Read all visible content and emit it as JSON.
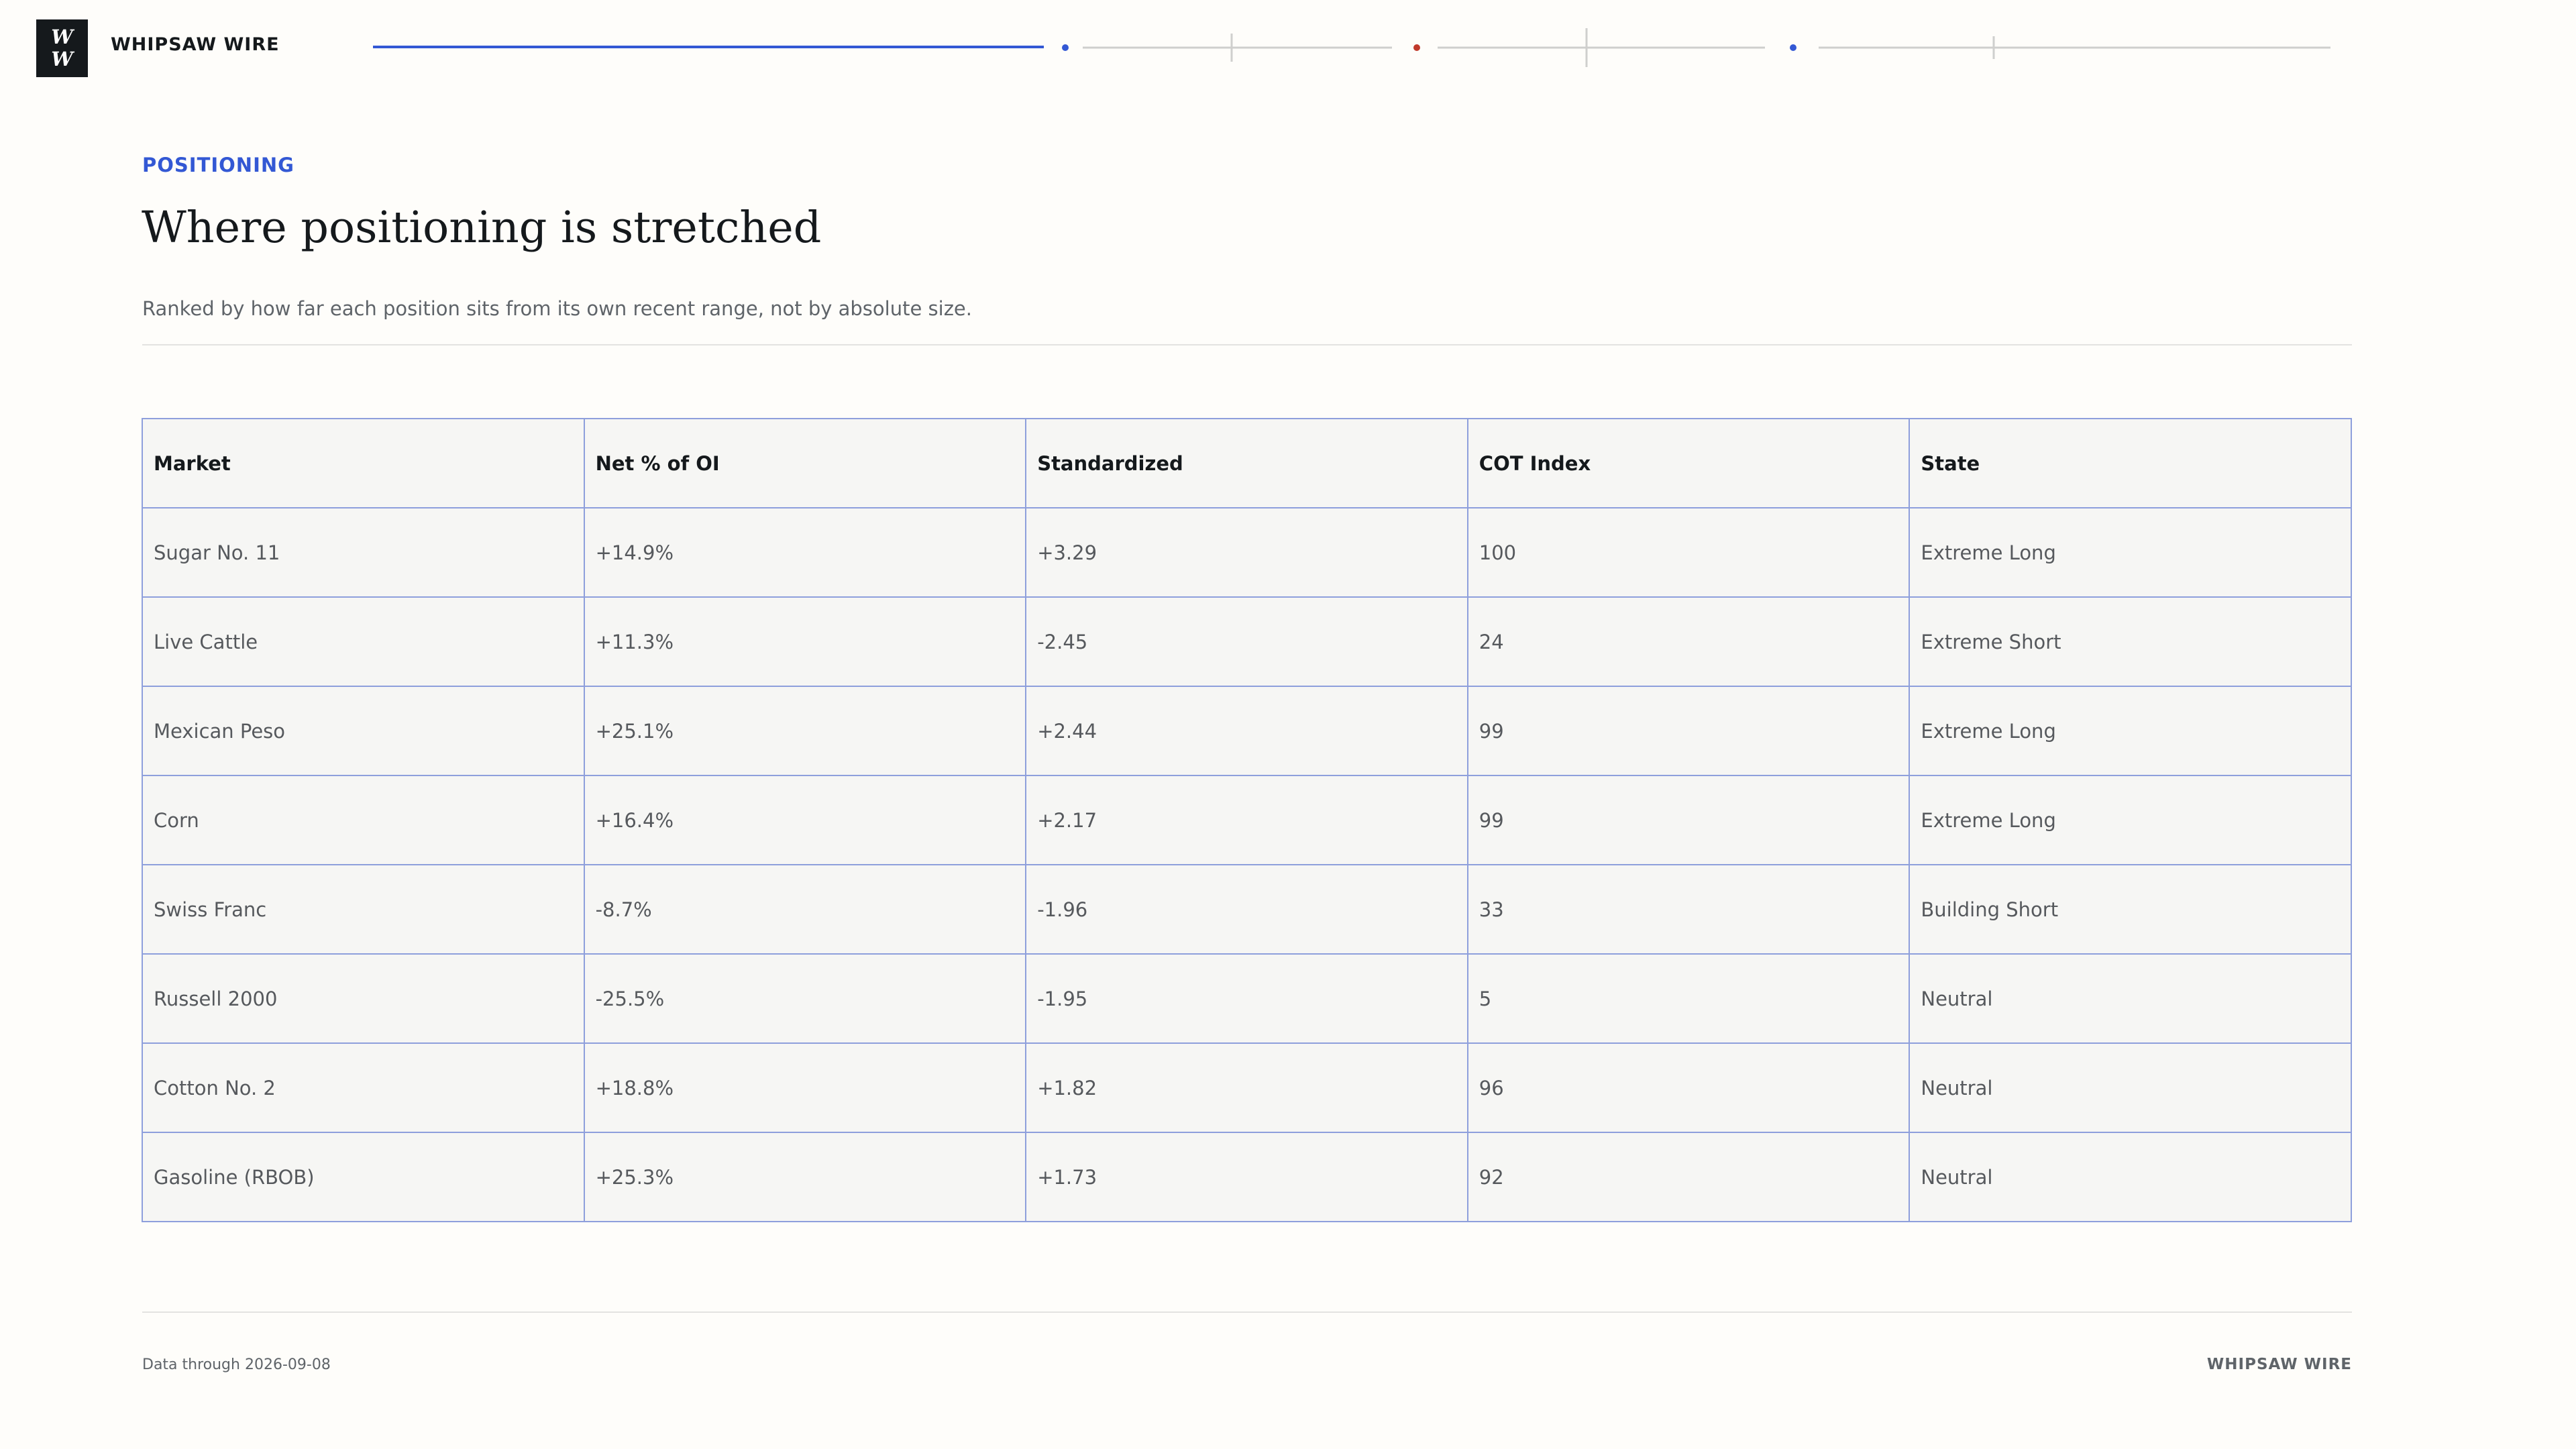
{
  "brand": {
    "logo_text": "W\nW",
    "name": "WHIPSAW WIRE"
  },
  "progress": {
    "colors": {
      "active": "#3358d4",
      "track": "#cfcfcd",
      "alert": "#c0392b"
    }
  },
  "header": {
    "eyebrow": "POSITIONING",
    "title": "Where positioning is stretched",
    "subtitle": "Ranked by how far each position sits from its own recent range, not by absolute size."
  },
  "table": {
    "columns": [
      "Market",
      "Net % of OI",
      "Standardized",
      "COT Index",
      "State"
    ],
    "rows": [
      [
        "Sugar No. 11",
        "+14.9%",
        "+3.29",
        "100",
        "Extreme Long"
      ],
      [
        "Live Cattle",
        "+11.3%",
        "-2.45",
        "24",
        "Extreme Short"
      ],
      [
        "Mexican Peso",
        "+25.1%",
        "+2.44",
        "99",
        "Extreme Long"
      ],
      [
        "Corn",
        "+16.4%",
        "+2.17",
        "99",
        "Extreme Long"
      ],
      [
        "Swiss Franc",
        "-8.7%",
        "-1.96",
        "33",
        "Building Short"
      ],
      [
        "Russell 2000",
        "-25.5%",
        "-1.95",
        "5",
        "Neutral"
      ],
      [
        "Cotton No. 2",
        "+18.8%",
        "+1.82",
        "96",
        "Neutral"
      ],
      [
        "Gasoline (RBOB)",
        "+25.3%",
        "+1.73",
        "92",
        "Neutral"
      ]
    ]
  },
  "footer": {
    "data_note": "Data through 2026-09-08",
    "brand": "WHIPSAW WIRE"
  }
}
